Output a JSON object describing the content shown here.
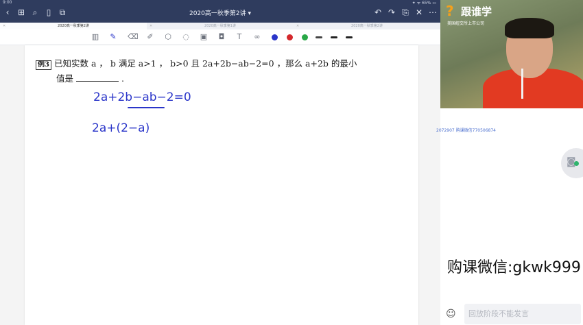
{
  "status": {
    "time": "9:00",
    "indicators": "✦ ᯤ 65% ▭"
  },
  "nav": {
    "back_icon": "chevron-left-icon",
    "grid_icon": "grid-icon",
    "search_icon": "search-icon",
    "bookmark_icon": "bookmark-icon",
    "share_icon": "share-icon",
    "title": "2020高一秋季第2讲",
    "title_suffix": "▾",
    "undo_icon": "undo-icon",
    "redo_icon": "redo-icon",
    "export_icon": "export-icon",
    "close_icon": "close-icon",
    "more_icon": "more-icon"
  },
  "tabs": [
    {
      "label": "2020高一秋季第2讲",
      "active": true
    },
    {
      "label": "2020高一秋季第1讲",
      "active": false
    },
    {
      "label": "2020高一秋季第2讲",
      "active": false
    }
  ],
  "toolbar": {
    "colors": [
      "#2a35c9",
      "#d4282c",
      "#29a847"
    ],
    "pen_color": "#2a35c9"
  },
  "problem": {
    "number": "例3",
    "line1": "已知实数 a ， b 满足 a>1 ， b>0 且 2a+2b−ab−2=0 ，那么 a+2b 的最小",
    "line2_prefix": "值是",
    "line2_suffix": "."
  },
  "handwriting": {
    "line1": "2a+2b−ab−2=0",
    "line2": "2a+(2−a)"
  },
  "video": {
    "brand_mark": "?",
    "brand_name": "跟谁学",
    "brand_sub": "美国纽交所上市公司"
  },
  "watermark": "2072907 购课微信770506874",
  "promo": "购课微信:gkwk999",
  "chat": {
    "placeholder": "回放阶段不能发言"
  }
}
